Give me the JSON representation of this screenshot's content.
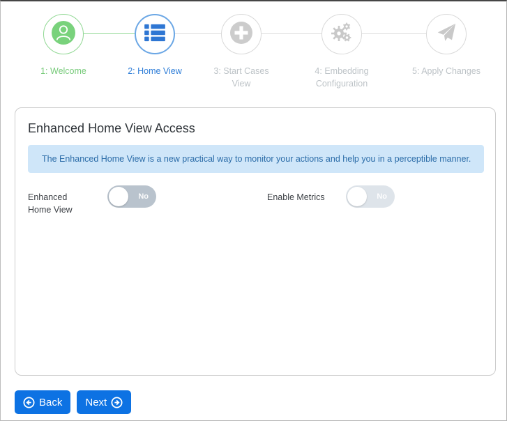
{
  "stepper": {
    "steps": [
      {
        "label": "1: Welcome",
        "icon": "user-circle-icon",
        "status": "completed"
      },
      {
        "label": "2: Home View",
        "icon": "list-icon",
        "status": "active"
      },
      {
        "label": "3: Start Cases View",
        "icon": "plus-circle-icon",
        "status": "pending"
      },
      {
        "label": "4: Embedding Configuration",
        "icon": "gears-icon",
        "status": "pending"
      },
      {
        "label": "5: Apply Changes",
        "icon": "paper-plane-icon",
        "status": "pending"
      }
    ]
  },
  "panel": {
    "title": "Enhanced Home View Access",
    "info_message": "The Enhanced Home View is a new practical way to monitor your actions and help you in a perceptible manner."
  },
  "toggles": [
    {
      "label": "Enhanced Home View",
      "value": "No",
      "state": "off"
    },
    {
      "label": "Enable Metrics",
      "value": "No",
      "state": "off"
    }
  ],
  "actions": {
    "back_label": "Back",
    "next_label": "Next"
  },
  "colors": {
    "step_completed": "#76ca79",
    "step_active": "#2f7ed8",
    "step_pending": "#bdc3c7",
    "alert_bg": "#cfe6f9",
    "alert_text": "#2b6ca8",
    "toggle_off_bg": "#b9c3cd",
    "toggle_off_disabled_bg": "#dee4ea",
    "button_bg": "#0d72e3"
  }
}
